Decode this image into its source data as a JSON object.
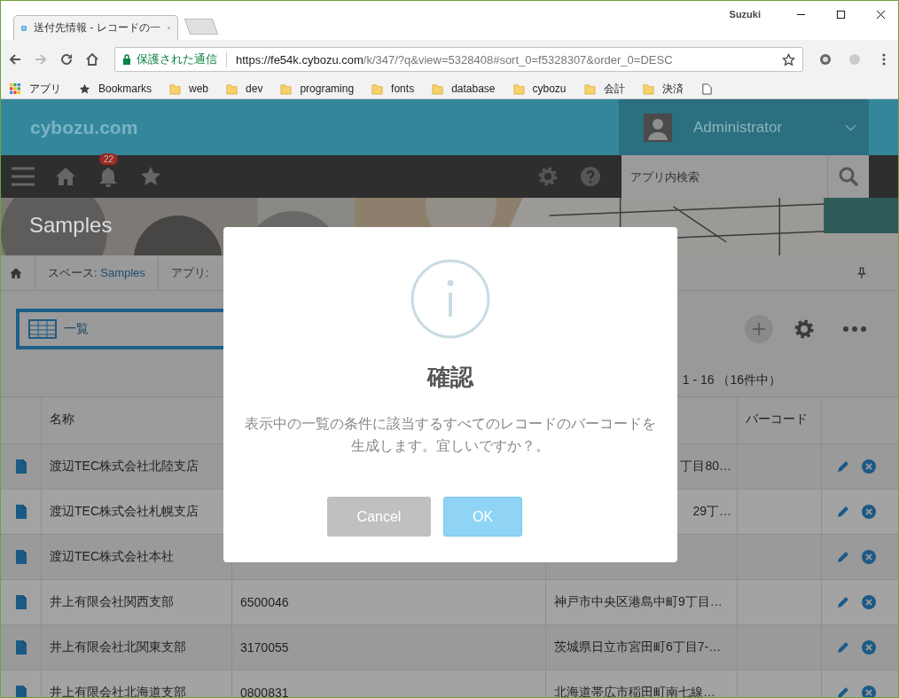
{
  "browser": {
    "tab_title": "送付先情報 - レコードの一",
    "profile": "Suzuki",
    "security": "保護された通信",
    "url_host": "https://fe54k.cybozu.com",
    "url_path": "/k/347/?q&view=5328408#sort_0=f5328307&order_0=DESC",
    "bookmarks": [
      {
        "kind": "apps",
        "label": "アプリ"
      },
      {
        "kind": "star",
        "label": "Bookmarks"
      },
      {
        "kind": "folder",
        "label": "web"
      },
      {
        "kind": "folder",
        "label": "dev"
      },
      {
        "kind": "folder",
        "label": "programing"
      },
      {
        "kind": "folder",
        "label": "fonts"
      },
      {
        "kind": "folder",
        "label": "database"
      },
      {
        "kind": "folder",
        "label": "cybozu"
      },
      {
        "kind": "folder",
        "label": "会計"
      },
      {
        "kind": "folder",
        "label": "決済"
      },
      {
        "kind": "page"
      }
    ]
  },
  "header": {
    "logo": "cybozu.com",
    "user": "Administrator",
    "notification_count": "22",
    "search": {
      "placeholder": "アプリ内検索"
    }
  },
  "space_title": "Samples",
  "breadcrumb": [
    {
      "prefix": "スペース: ",
      "link": "Samples"
    },
    {
      "prefix": "アプリ: "
    }
  ],
  "view": {
    "label": "一覧",
    "count": "1 - 16 （16件中）"
  },
  "table": {
    "columns": [
      "名称",
      null,
      null,
      "バーコード"
    ],
    "rows": [
      {
        "name": "渡辺TEC株式会社北陸支店",
        "address_tail": "丁目80…"
      },
      {
        "name": "渡辺TEC株式会社札幌支店",
        "address_tail": "29丁…"
      },
      {
        "name": "渡辺TEC株式会社本社"
      },
      {
        "name": "井上有限会社関西支部",
        "postal": "6500046",
        "address": "神戸市中央区港島中町9丁目…"
      },
      {
        "name": "井上有限会社北関東支部",
        "postal": "3170055",
        "address": "茨城県日立市宮田町6丁目7-…"
      },
      {
        "name": "井上有限会社北海道支部",
        "postal": "0800831",
        "address": "北海道帯広市稲田町南七線…"
      }
    ]
  },
  "dialog": {
    "title": "確認",
    "message_lines": [
      "表示中の一覧の条件に該当するすべてのレコードのバーコードを",
      "生成します。宜しいですか？。"
    ],
    "buttons": [
      {
        "kind": "cancel",
        "label": "Cancel"
      },
      {
        "kind": "ok",
        "label": "OK"
      }
    ]
  }
}
